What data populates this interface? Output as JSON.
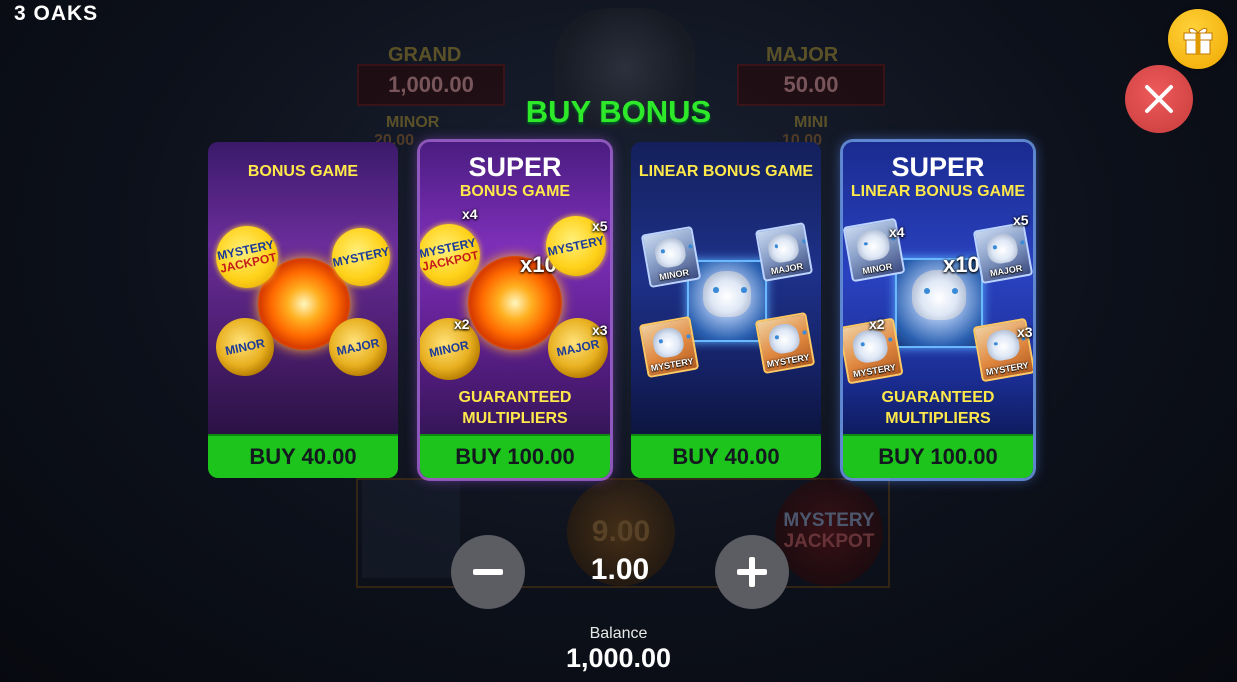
{
  "brand": "3 OAKS",
  "title": "BUY BONUS",
  "background": {
    "jackpots": [
      {
        "label": "GRAND",
        "value": "1,000.00"
      },
      {
        "label": "MAJOR",
        "value": "50.00"
      },
      {
        "label": "MINOR",
        "value": "20.00"
      },
      {
        "label": "MINI",
        "value": "10.00"
      }
    ],
    "coin_value": "9.00",
    "mystery_word": "MYSTERY",
    "jackpot_word": "JACKPOT"
  },
  "cards": [
    {
      "super": "",
      "subtitle": "BONUS GAME",
      "guarantee_line1": "",
      "guarantee_line2": "",
      "buy_label": "BUY 40.00",
      "coins": {
        "mystery": "MYSTERY",
        "jackpot": "JACKPOT",
        "minor": "MINOR",
        "major": "MAJOR"
      }
    },
    {
      "super": "SUPER",
      "subtitle": "BONUS GAME",
      "guarantee_line1": "GUARANTEED",
      "guarantee_line2": "MULTIPLIERS",
      "buy_label": "BUY 100.00",
      "coins": {
        "mystery": "MYSTERY",
        "jackpot": "JACKPOT",
        "minor": "MINOR",
        "major": "MAJOR"
      },
      "multipliers": {
        "center": "x10",
        "mystery_jackpot": "x4",
        "mystery": "x5",
        "minor": "x2",
        "major": "x3"
      }
    },
    {
      "super": "",
      "subtitle": "LINEAR BONUS GAME",
      "guarantee_line1": "",
      "guarantee_line2": "",
      "buy_label": "BUY 40.00",
      "tiles": {
        "minor": "MINOR",
        "major": "MAJOR",
        "mystery": "MYSTERY"
      }
    },
    {
      "super": "SUPER",
      "subtitle": "LINEAR BONUS GAME",
      "guarantee_line1": "GUARANTEED",
      "guarantee_line2": "MULTIPLIERS",
      "buy_label": "BUY 100.00",
      "tiles": {
        "minor": "MINOR",
        "major": "MAJOR",
        "mystery": "MYSTERY"
      },
      "multipliers": {
        "center": "x10",
        "minor": "x4",
        "major": "x5",
        "mystery_left": "x2",
        "mystery_right": "x3"
      }
    }
  ],
  "bet": {
    "value": "1.00",
    "minus_icon": "minus-icon",
    "plus_icon": "plus-icon"
  },
  "balance": {
    "label": "Balance",
    "value": "1,000.00"
  },
  "colors": {
    "accent_green": "#2ee82a",
    "buy_button": "#1cc41c",
    "gold": "#f0a800",
    "close_red": "#d94848"
  }
}
